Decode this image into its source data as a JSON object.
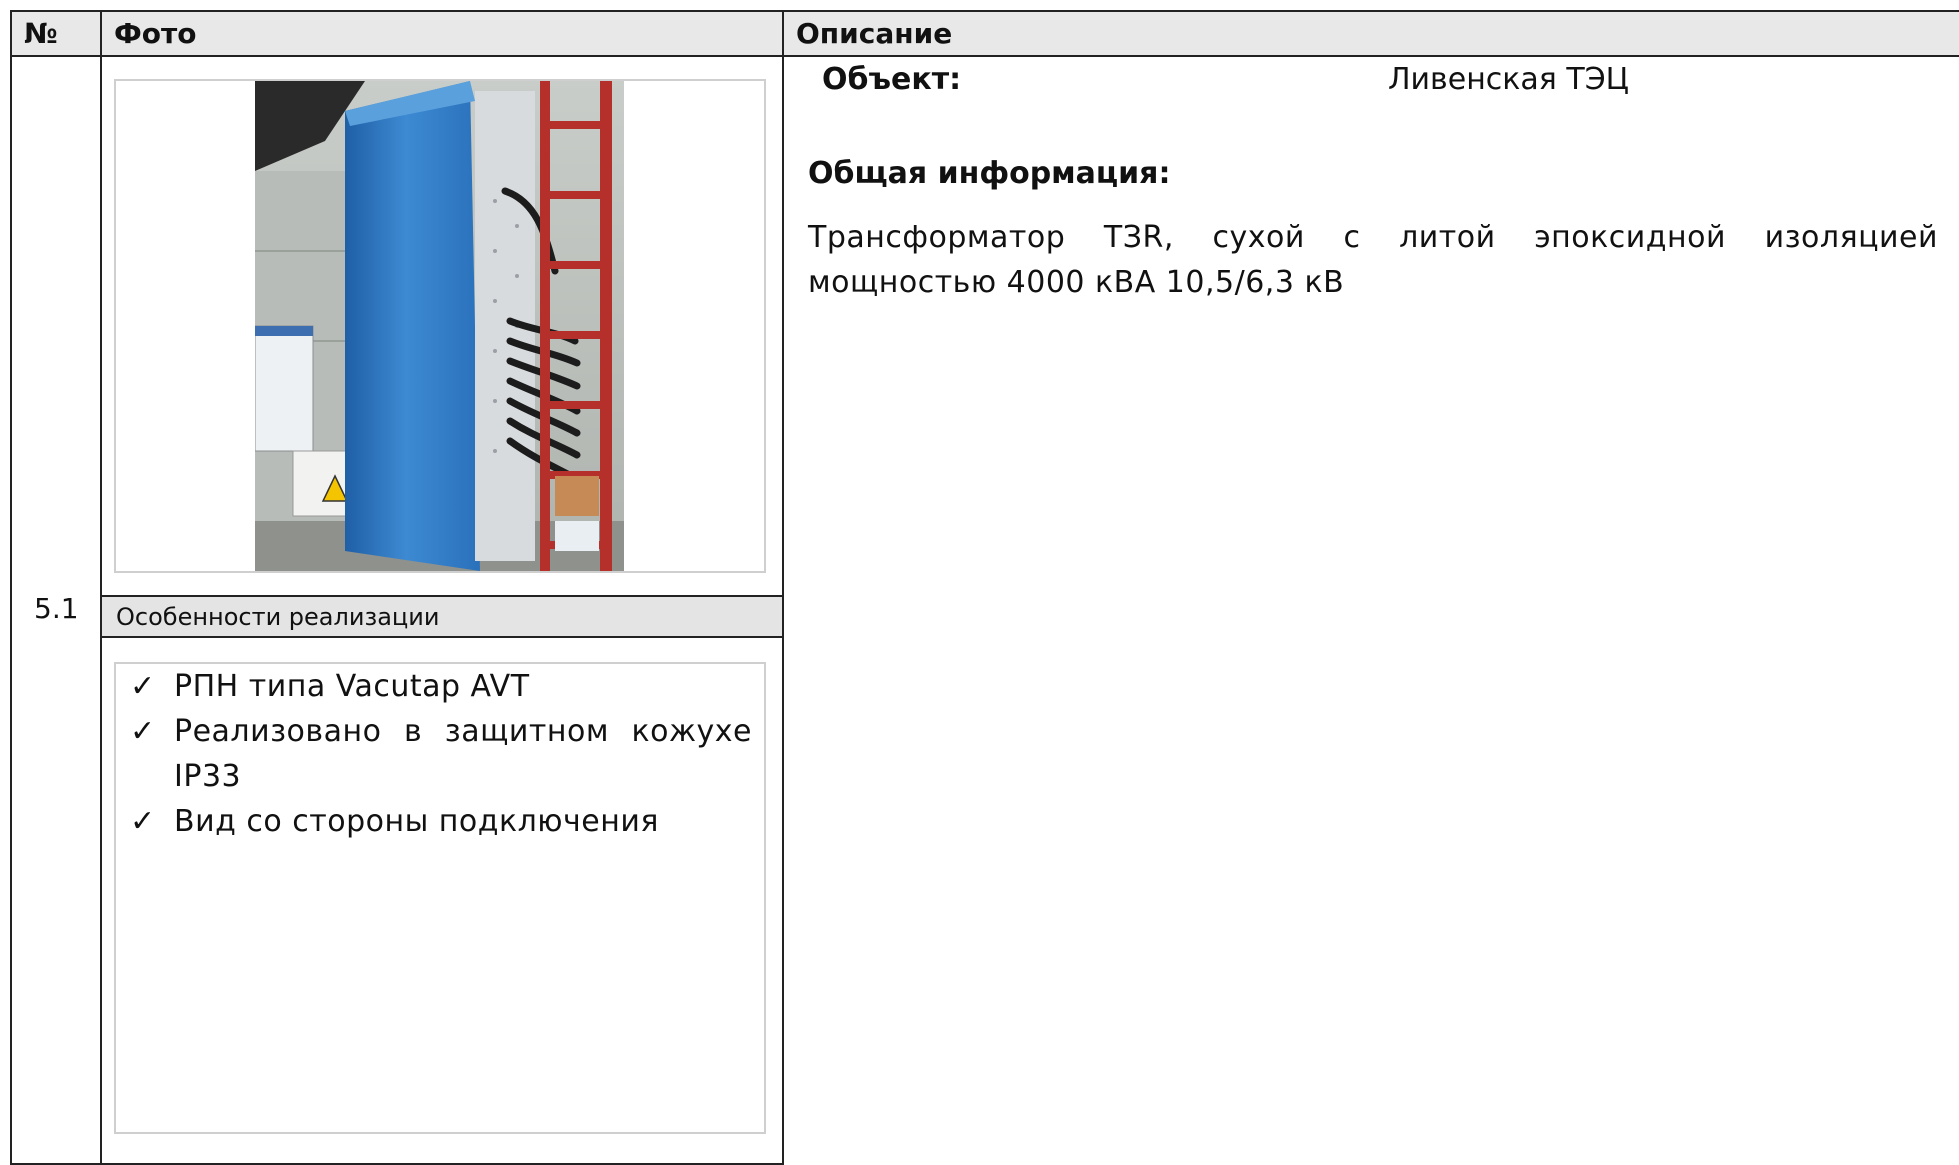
{
  "table": {
    "headers": {
      "number": "№",
      "photo": "Фото",
      "description": "Описание"
    },
    "row": {
      "number": "5.1",
      "features_header": "Особенности реализации",
      "features": [
        "РПН типа Vacutap AVT",
        "Реализовано в защитном кожухе IP33",
        "Вид со стороны подключения"
      ],
      "object_label": "Объект:",
      "object_value": "Ливенская ТЭЦ",
      "general_info_label": "Общая информация:",
      "general_info_text": "Трансформатор ТЗR, сухой с литой эпоксидной изоляцией мощностью 4000 кВА 10,5/6,3 кВ",
      "check_symbol": "✓"
    }
  },
  "colors": {
    "header_bg": "#e8e8e8",
    "transformer_blue": "#3a86c8",
    "frame_red": "#b5302a"
  }
}
